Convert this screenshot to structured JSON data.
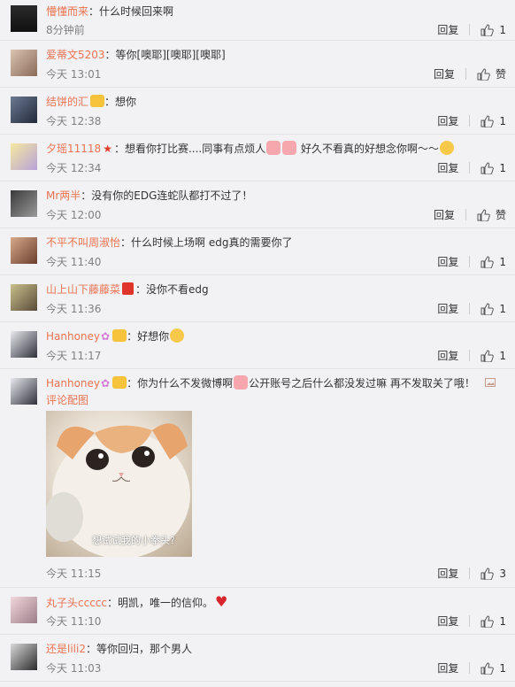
{
  "comments": [
    {
      "user": "懵懂而来",
      "text": "：什么时候回来啊",
      "time": "8分钟前",
      "reply": "回复",
      "likes": "1"
    },
    {
      "user": "爱蒂文5203",
      "text": "：等你[噢耶][噢耶][噢耶]",
      "time": "今天 13:01",
      "reply": "回复",
      "likes": "赞"
    },
    {
      "user": "结饼的汇",
      "text": "：想你",
      "time": "今天 12:38",
      "reply": "回复",
      "likes": "1"
    },
    {
      "user": "夕瑶11118",
      "text": "：想看你打比赛....同事有点烦人",
      "text2": " 好久不看真的好想念你啊～～",
      "time": "今天 12:34",
      "reply": "回复",
      "likes": "1"
    },
    {
      "user": "Mr两半",
      "text": "：没有你的EDG连蛇队都打不过了！",
      "time": "今天 12:00",
      "reply": "回复",
      "likes": "赞"
    },
    {
      "user": "不平不叫周淑怡",
      "text": "：什么时候上场啊 edg真的需要你了",
      "time": "今天 11:40",
      "reply": "回复",
      "likes": "1"
    },
    {
      "user": "山上山下藤藤菜",
      "text": "：没你不看edg",
      "time": "今天 11:36",
      "reply": "回复",
      "likes": "1"
    },
    {
      "user": "Hanhoney",
      "text": "：好想你",
      "time": "今天 11:17",
      "reply": "回复",
      "likes": "1"
    },
    {
      "user": "Hanhoney",
      "text": "：你为什么不发微博啊",
      "text2": "公开账号之后什么都没发过嘛 再不发取关了哦！",
      "link": "评论配图",
      "pic_caption": "想试试我的小拳头?",
      "time": "今天 11:15",
      "reply": "回复",
      "likes": "3"
    },
    {
      "user": "丸子头ccccc",
      "text": "：明凯，唯一的信仰。",
      "time": "今天 11:10",
      "reply": "回复",
      "likes": "1"
    },
    {
      "user": "还是lili2",
      "text": "：等你回归，那个男人",
      "time": "今天 11:03",
      "reply": "回复",
      "likes": "1"
    }
  ],
  "colors": {
    "username": "#eb7350",
    "time": "#808080",
    "background": "#f2f2f5",
    "divider": "#e3e3e3"
  }
}
